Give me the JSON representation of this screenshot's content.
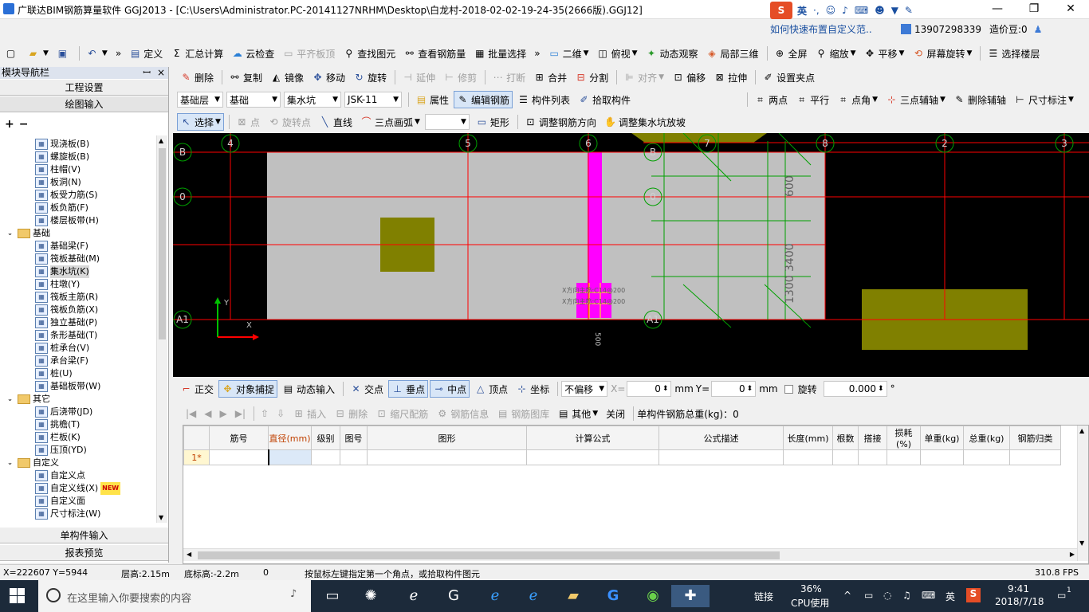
{
  "window": {
    "title": "广联达BIM钢筋算量软件 GGJ2013 - [C:\\Users\\Administrator.PC-20141127NRHM\\Desktop\\白龙村-2018-02-02-19-24-35(2666版).GGJ12]",
    "minimize": "—",
    "restore": "❐",
    "close": "✕"
  },
  "ime": {
    "logo": "S",
    "lang": "英",
    "hint": "如何快速布置自定义范..",
    "phone": "13907298339",
    "beans": "造价豆:0"
  },
  "toolbar1": {
    "items": [
      "定义",
      "汇总计算",
      "云检查",
      "平齐板顶",
      "查找图元",
      "查看钢筋量",
      "批量选择",
      "二维",
      "俯视",
      "动态观察",
      "局部三维",
      "全屏",
      "缩放",
      "平移",
      "屏幕旋转",
      "选择楼层"
    ]
  },
  "nav": {
    "title": "模块导航栏",
    "pin": "ꟷ",
    "close": "×",
    "btn_project": "工程设置",
    "btn_draw": "绘图输入",
    "btn_single": "单构件输入",
    "btn_report": "报表预览"
  },
  "tree": [
    {
      "label": "现浇板(B)",
      "type": "item"
    },
    {
      "label": "螺旋板(B)",
      "type": "item"
    },
    {
      "label": "柱帽(V)",
      "type": "item"
    },
    {
      "label": "板洞(N)",
      "type": "item"
    },
    {
      "label": "板受力筋(S)",
      "type": "item"
    },
    {
      "label": "板负筋(F)",
      "type": "item"
    },
    {
      "label": "楼层板带(H)",
      "type": "item"
    },
    {
      "label": "基础",
      "type": "folder"
    },
    {
      "label": "基础梁(F)",
      "type": "item"
    },
    {
      "label": "筏板基础(M)",
      "type": "item"
    },
    {
      "label": "集水坑(K)",
      "type": "item",
      "selected": true
    },
    {
      "label": "柱墩(Y)",
      "type": "item"
    },
    {
      "label": "筏板主筋(R)",
      "type": "item"
    },
    {
      "label": "筏板负筋(X)",
      "type": "item"
    },
    {
      "label": "独立基础(P)",
      "type": "item"
    },
    {
      "label": "条形基础(T)",
      "type": "item"
    },
    {
      "label": "桩承台(V)",
      "type": "item"
    },
    {
      "label": "承台梁(F)",
      "type": "item"
    },
    {
      "label": "桩(U)",
      "type": "item"
    },
    {
      "label": "基础板带(W)",
      "type": "item"
    },
    {
      "label": "其它",
      "type": "folder"
    },
    {
      "label": "后浇带(JD)",
      "type": "item"
    },
    {
      "label": "挑檐(T)",
      "type": "item"
    },
    {
      "label": "栏板(K)",
      "type": "item"
    },
    {
      "label": "压顶(YD)",
      "type": "item"
    },
    {
      "label": "自定义",
      "type": "folder"
    },
    {
      "label": "自定义点",
      "type": "item"
    },
    {
      "label": "自定义线(X)",
      "type": "item",
      "badge": "NEW"
    },
    {
      "label": "自定义面",
      "type": "item"
    },
    {
      "label": "尺寸标注(W)",
      "type": "item"
    }
  ],
  "toolbar2": {
    "items": [
      "删除",
      "复制",
      "镜像",
      "移动",
      "旋转",
      "延伸",
      "修剪",
      "打断",
      "合并",
      "分割",
      "对齐",
      "偏移",
      "拉伸",
      "设置夹点"
    ]
  },
  "toolbar3": {
    "layer": "基础层",
    "category": "基础",
    "type": "集水坑",
    "element": "JSK-11",
    "items": [
      "属性",
      "编辑钢筋",
      "构件列表",
      "拾取构件",
      "两点",
      "平行",
      "点角",
      "三点辅轴",
      "删除辅轴",
      "尺寸标注"
    ]
  },
  "toolbar4": {
    "items": [
      "选择",
      "点",
      "旋转点",
      "直线",
      "三点画弧",
      "矩形",
      "调整钢筋方向",
      "调整集水坑放坡"
    ]
  },
  "canvas": {
    "axis_top": [
      "4",
      "5",
      "6",
      "B",
      "7",
      "8",
      "2",
      "3"
    ],
    "axis_left": [
      "B",
      "0",
      "A1"
    ],
    "axis_mid": [
      "B",
      "0",
      "A1"
    ],
    "dim_text": [
      "600",
      "3400",
      "1300",
      "500"
    ],
    "rebar_labels": [
      "X方向主筋:C14@200",
      "X方向主筋:C14@200"
    ],
    "x_label": "X",
    "y_label": "Y"
  },
  "snapbar": {
    "items": [
      "正交",
      "对象捕捉",
      "动态输入",
      "交点",
      "垂点",
      "中点",
      "顶点",
      "坐标"
    ],
    "offset_mode": "不偏移",
    "x_label": "X=",
    "x_value": "0",
    "y_label": "Y=",
    "y_value": "0",
    "unit": "mm",
    "rotate_label": "旋转",
    "rotate_value": "0.000",
    "degree": "°"
  },
  "rebar_toolbar": {
    "items": [
      "插入",
      "删除",
      "缩尺配筋",
      "钢筋信息",
      "钢筋图库",
      "其他",
      "关闭"
    ],
    "total_label": "单构件钢筋总重(kg)：0"
  },
  "grid": {
    "columns": [
      "筋号",
      "直径(mm)",
      "级别",
      "图号",
      "图形",
      "计算公式",
      "公式描述",
      "长度(mm)",
      "根数",
      "搭接",
      "损耗(%)",
      "单重(kg)",
      "总重(kg)",
      "钢筋归类"
    ],
    "row_header": "1*"
  },
  "status": {
    "coords": "X=222607 Y=5944",
    "floor_height": "层高:2.15m",
    "base_height": "底标高:-2.2m",
    "count": "0",
    "hint": "按鼠标左键指定第一个角点，或拾取构件图元",
    "fps": "310.8 FPS"
  },
  "taskbar": {
    "search_placeholder": "在这里输入你要搜索的内容",
    "link": "链接",
    "cpu_pct": "36%",
    "cpu_label": "CPU使用",
    "lang": "英",
    "time": "9:41",
    "date": "2018/7/18",
    "notif": "1"
  },
  "colors": {
    "canvas_bg": "#000000",
    "slab": "#c0c0c0",
    "pit": "#808000",
    "magenta": "#ff00ff",
    "grid_red": "#ff0000",
    "axis_green": "#00a000"
  }
}
